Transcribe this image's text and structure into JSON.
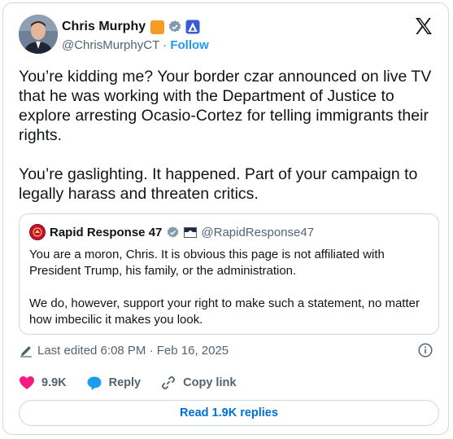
{
  "author": {
    "name": "Chris Murphy",
    "handle": "@ChrisMurphyCT",
    "separator": "·",
    "follow_label": "Follow"
  },
  "tweet": {
    "text": "You’re kidding me? Your border czar announced on live TV that he was working with the Department of Justice to explore arresting Ocasio-Cortez for telling immigrants their rights.\n\nYou’re gaslighting. It happened. Part of your campaign to legally harass and threaten critics."
  },
  "quote": {
    "name": "Rapid Response 47",
    "handle": "@RapidResponse47",
    "text": "You are a moron, Chris. It is obvious this page is not affiliated with President Trump, his family, or the administration.\n\nWe do, however, support your right to make such a statement, no matter how imbecilic it makes you look."
  },
  "meta": {
    "edited": "Last edited 6:08 PM · Feb 16, 2025"
  },
  "actions": {
    "likes": "9.9K",
    "reply_label": "Reply",
    "copy_label": "Copy link"
  },
  "replies_button": "Read 1.9K replies",
  "colors": {
    "link": "#1d9bf0",
    "like": "#f91880",
    "org_badge": "#f59a23"
  }
}
